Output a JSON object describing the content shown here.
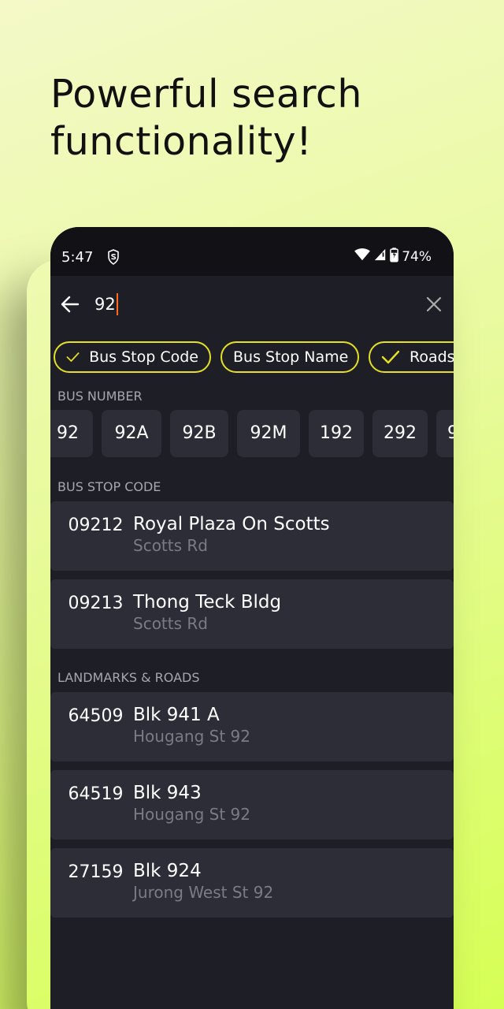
{
  "headline": {
    "line1": "Powerful search",
    "line2": "functionality!"
  },
  "status_bar": {
    "time": "5:47",
    "battery": "74%",
    "icons": [
      "shield-s-icon",
      "wifi-icon",
      "signal-icon",
      "battery-charging-icon"
    ]
  },
  "search": {
    "query": "92",
    "back_icon": "arrow-left-icon",
    "clear_icon": "close-icon"
  },
  "filters": [
    {
      "label": "Bus Stop Code",
      "checked": true
    },
    {
      "label": "Bus Stop Name",
      "checked": false
    },
    {
      "label": "Roads",
      "checked": true
    }
  ],
  "sections": {
    "bus_number": "BUS NUMBER",
    "bus_stop_code": "BUS STOP CODE",
    "landmarks_roads": "LANDMARKS & ROADS"
  },
  "bus_numbers": [
    "92",
    "92A",
    "92B",
    "92M",
    "192",
    "292",
    "9"
  ],
  "bus_stops": [
    {
      "code": "09212",
      "name": "Royal Plaza On Scotts",
      "road": "Scotts Rd"
    },
    {
      "code": "09213",
      "name": "Thong Teck Bldg",
      "road": "Scotts Rd"
    }
  ],
  "landmarks": [
    {
      "code": "64509",
      "name": "Blk 941 A",
      "road": "Hougang St 92"
    },
    {
      "code": "64519",
      "name": "Blk 943",
      "road": "Hougang St 92"
    },
    {
      "code": "27159",
      "name": "Blk 924",
      "road": "Jurong West St 92"
    }
  ],
  "colors": {
    "accent": "#e6e020",
    "caret": "#ff6a1a",
    "card": "#2d2d38",
    "background": "#1e1e26"
  }
}
